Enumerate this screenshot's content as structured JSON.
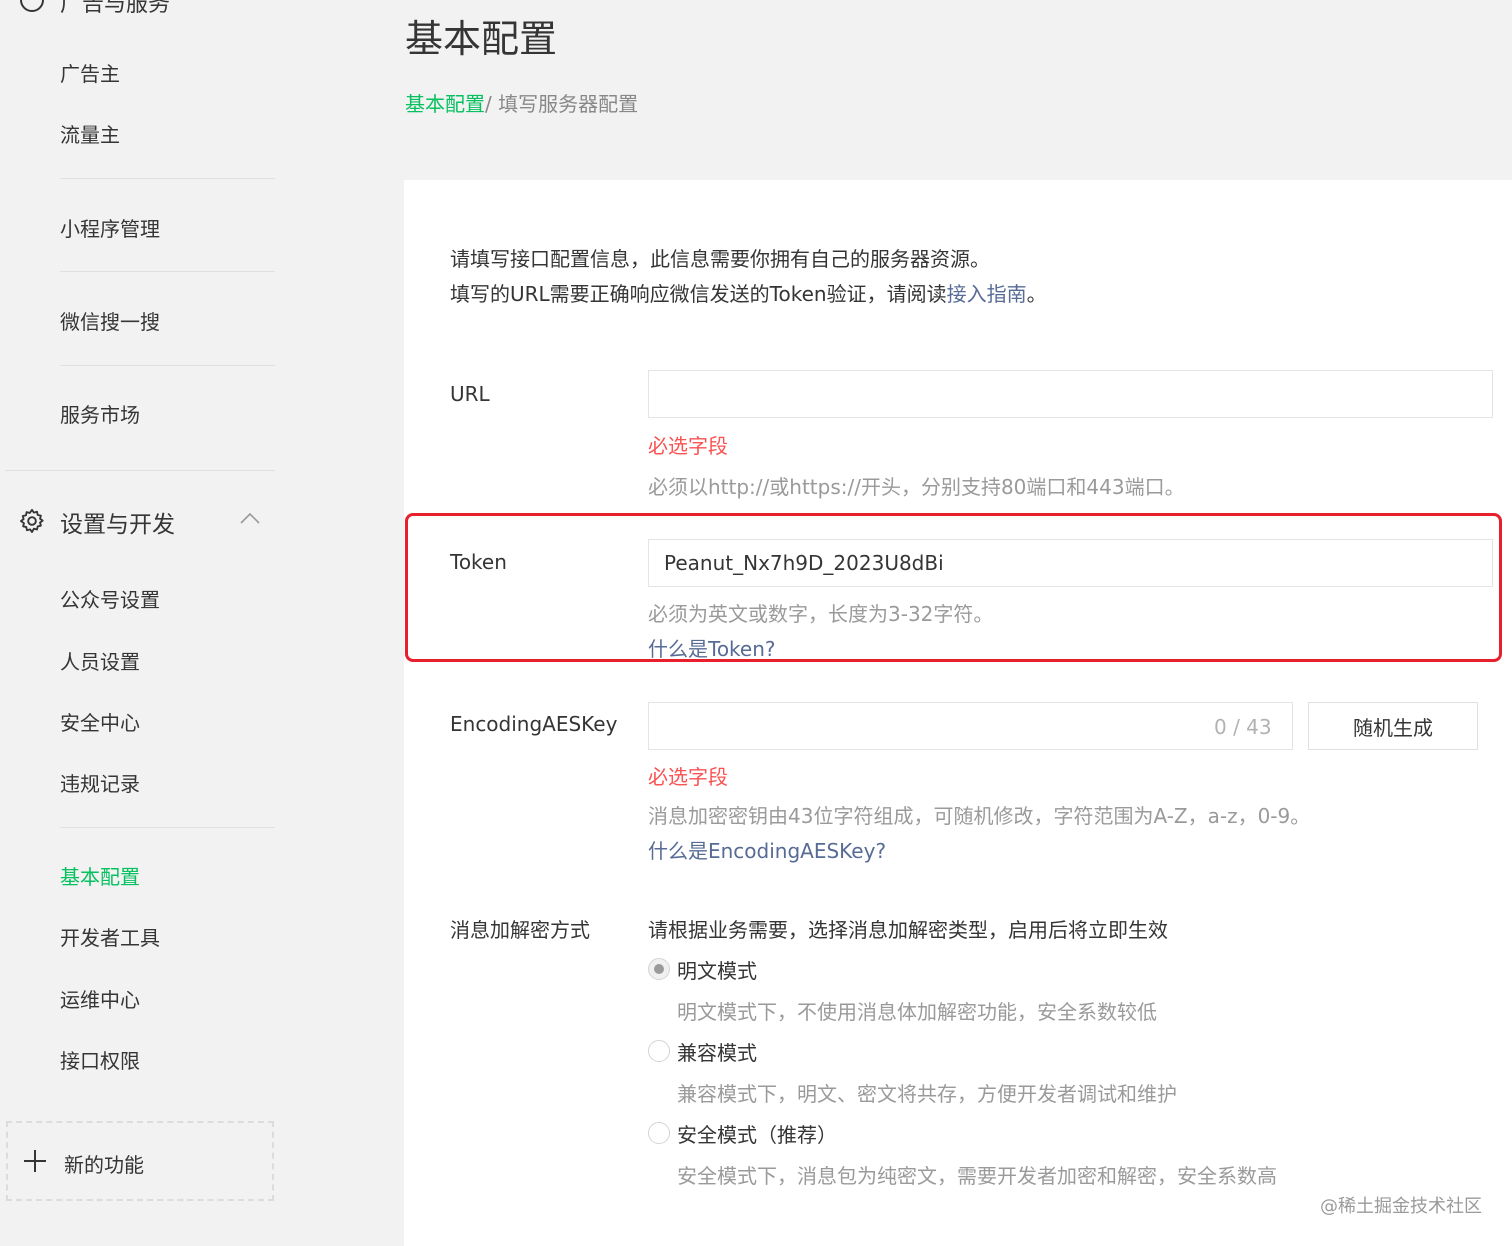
{
  "sidebar": {
    "top_cut_label": "广告与服务",
    "items_group1": [
      "广告主",
      "流量主"
    ],
    "item_mini_program": "小程序管理",
    "item_wechat_search": "微信搜一搜",
    "item_service_market": "服务市场",
    "section_title": "设置与开发",
    "settings_items": [
      "公众号设置",
      "人员设置",
      "安全中心",
      "违规记录"
    ],
    "dev_items": [
      "基本配置",
      "开发者工具",
      "运维中心",
      "接口权限"
    ],
    "active_item": "基本配置",
    "new_function_label": "新的功能"
  },
  "header": {
    "title": "基本配置",
    "breadcrumb_link": "基本配置",
    "breadcrumb_current": "/ 填写服务器配置"
  },
  "intro": {
    "line1": "请填写接口配置信息，此信息需要你拥有自己的服务器资源。",
    "line2_prefix": "填写的URL需要正确响应微信发送的Token验证，请阅读",
    "line2_link": "接入指南",
    "line2_suffix": "。"
  },
  "form": {
    "url": {
      "label": "URL",
      "value": "",
      "error": "必选字段",
      "hint": "必须以http://或https://开头，分别支持80端口和443端口。"
    },
    "token": {
      "label": "Token",
      "value": "Peanut_Nx7h9D_2023U8dBi",
      "hint": "必须为英文或数字，长度为3-32字符。",
      "link": "什么是Token?"
    },
    "aes_key": {
      "label": "EncodingAESKey",
      "value": "",
      "counter": "0 / 43",
      "button": "随机生成",
      "error": "必选字段",
      "hint": "消息加密密钥由43位字符组成，可随机修改，字符范围为A-Z，a-z，0-9。",
      "link": "什么是EncodingAESKey?"
    },
    "encryption": {
      "label": "消息加解密方式",
      "desc": "请根据业务需要，选择消息加解密类型，启用后将立即生效",
      "options": [
        {
          "label": "明文模式",
          "hint": "明文模式下，不使用消息体加解密功能，安全系数较低",
          "checked": true
        },
        {
          "label": "兼容模式",
          "hint": "兼容模式下，明文、密文将共存，方便开发者调试和维护",
          "checked": false
        },
        {
          "label": "安全模式（推荐）",
          "hint": "安全模式下，消息包为纯密文，需要开发者加密和解密，安全系数高",
          "checked": false
        }
      ]
    }
  },
  "annotation": {
    "highlight_color": "#e8202e"
  },
  "colors": {
    "accent": "#07c160",
    "link": "#576b95",
    "error": "#fa5151"
  },
  "watermark": "@稀土掘金技术社区"
}
